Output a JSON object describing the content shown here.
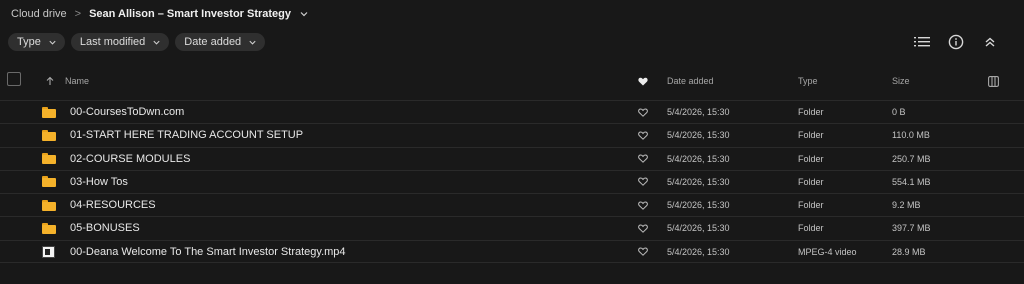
{
  "breadcrumb": {
    "root": "Cloud drive",
    "separator": ">",
    "current": "Sean Allison – Smart Investor Strategy"
  },
  "filters": [
    {
      "label": "Type"
    },
    {
      "label": "Last modified"
    },
    {
      "label": "Date added"
    }
  ],
  "toolbar_icons": [
    "list-view-icon",
    "info-icon",
    "collapse-icon"
  ],
  "columns": {
    "name": "Name",
    "date_added": "Date added",
    "type": "Type",
    "size": "Size"
  },
  "files": [
    {
      "name": "00-CoursesToDwn.com",
      "date_added": "5/4/2026, 15:30",
      "type": "Folder",
      "size": "0 B",
      "icon": "folder-icon"
    },
    {
      "name": "01-START HERE TRADING ACCOUNT SETUP",
      "date_added": "5/4/2026, 15:30",
      "type": "Folder",
      "size": "110.0 MB",
      "icon": "folder-icon"
    },
    {
      "name": "02-COURSE MODULES",
      "date_added": "5/4/2026, 15:30",
      "type": "Folder",
      "size": "250.7 MB",
      "icon": "folder-icon"
    },
    {
      "name": "03-How Tos",
      "date_added": "5/4/2026, 15:30",
      "type": "Folder",
      "size": "554.1 MB",
      "icon": "folder-icon"
    },
    {
      "name": "04-RESOURCES",
      "date_added": "5/4/2026, 15:30",
      "type": "Folder",
      "size": "9.2 MB",
      "icon": "folder-icon"
    },
    {
      "name": "05-BONUSES",
      "date_added": "5/4/2026, 15:30",
      "type": "Folder",
      "size": "397.7 MB",
      "icon": "folder-icon"
    },
    {
      "name": "00-Deana Welcome To The Smart Investor Strategy.mp4",
      "date_added": "5/4/2026, 15:30",
      "type": "MPEG-4 video",
      "size": "28.9 MB",
      "icon": "video-thumbnail-icon"
    }
  ],
  "colors": {
    "background": "#181818",
    "chip": "#2f2f2f",
    "folder": "#f5b22a",
    "text": "#e6e6e6",
    "muted_text": "#a6a6a6"
  }
}
